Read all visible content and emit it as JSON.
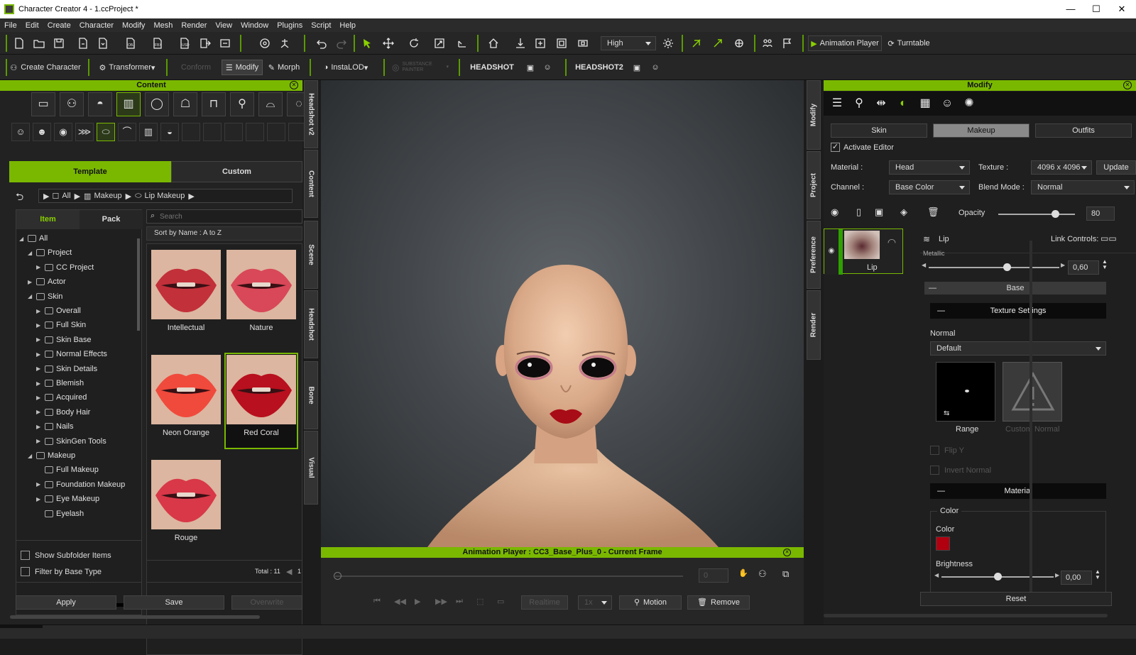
{
  "window": {
    "title": "Character Creator 4 - 1.ccProject *"
  },
  "menu": [
    "File",
    "Edit",
    "Create",
    "Character",
    "Modify",
    "Mesh",
    "Render",
    "View",
    "Window",
    "Plugins",
    "Script",
    "Help"
  ],
  "toolbar1": {
    "quality": "High",
    "animation_player": "Animation Player",
    "turntable": "Turntable"
  },
  "toolbar2": {
    "create_character": "Create Character",
    "transformer": "Transformer",
    "conform": "Conform",
    "modify": "Modify",
    "morph": "Morph",
    "instalod": "InstaLOD",
    "substance": "SUBSTANCE PAINTER",
    "headshot": "HEADSHOT",
    "headshot2": "HEADSHOT2"
  },
  "content": {
    "title": "Content",
    "tabs": {
      "template": "Template",
      "custom": "Custom"
    },
    "breadcrumb": {
      "all": "All",
      "makeup": "Makeup",
      "lip": "Lip Makeup"
    },
    "subtabs": {
      "item": "Item",
      "pack": "Pack"
    },
    "search_placeholder": "Search",
    "sort": "Sort by Name : A to Z",
    "tree": [
      {
        "label": "All",
        "indent": 0,
        "arrow": "◢"
      },
      {
        "label": "Project",
        "indent": 1,
        "arrow": "◢"
      },
      {
        "label": "CC Project",
        "indent": 2,
        "arrow": "▶"
      },
      {
        "label": "Actor",
        "indent": 1,
        "arrow": "▶"
      },
      {
        "label": "Skin",
        "indent": 1,
        "arrow": "◢"
      },
      {
        "label": "Overall",
        "indent": 2,
        "arrow": "▶"
      },
      {
        "label": "Full Skin",
        "indent": 2,
        "arrow": "▶"
      },
      {
        "label": "Skin Base",
        "indent": 2,
        "arrow": "▶"
      },
      {
        "label": "Normal Effects",
        "indent": 2,
        "arrow": "▶"
      },
      {
        "label": "Skin Details",
        "indent": 2,
        "arrow": "▶"
      },
      {
        "label": "Blemish",
        "indent": 2,
        "arrow": "▶"
      },
      {
        "label": "Acquired",
        "indent": 2,
        "arrow": "▶"
      },
      {
        "label": "Body Hair",
        "indent": 2,
        "arrow": "▶"
      },
      {
        "label": "Nails",
        "indent": 2,
        "arrow": "▶"
      },
      {
        "label": "SkinGen Tools",
        "indent": 2,
        "arrow": "▶"
      },
      {
        "label": "Makeup",
        "indent": 1,
        "arrow": "◢"
      },
      {
        "label": "Full Makeup",
        "indent": 2,
        "arrow": ""
      },
      {
        "label": "Foundation Makeup",
        "indent": 2,
        "arrow": "▶"
      },
      {
        "label": "Eye Makeup",
        "indent": 2,
        "arrow": "▶"
      },
      {
        "label": "Eyelash",
        "indent": 2,
        "arrow": ""
      }
    ],
    "items": [
      {
        "label": "Intellectual",
        "color": "#c2303a"
      },
      {
        "label": "Nature",
        "color": "#d84858"
      },
      {
        "label": "Neon Orange",
        "color": "#f04a3c"
      },
      {
        "label": "Red Coral",
        "color": "#b8101e"
      },
      {
        "label": "Rouge",
        "color": "#d83848"
      }
    ],
    "show_subfolder": "Show Subfolder Items",
    "filter_base": "Filter by Base Type",
    "total": "Total : 11",
    "page": "1",
    "apply": "Apply",
    "save": "Save",
    "overwrite": "Overwrite"
  },
  "left_vtabs": [
    "Headshot v2",
    "Content",
    "Scene",
    "Headshot",
    "Bone",
    "Visual"
  ],
  "right_vtabs": [
    "Modify",
    "Project",
    "Preference",
    "Render"
  ],
  "anim": {
    "title": "Animation Player : CC3_Base_Plus_0 - Current Frame",
    "frame": "0",
    "realtime": "Realtime",
    "speed": "1x",
    "motion": "Motion",
    "remove": "Remove"
  },
  "modify": {
    "title": "Modify",
    "tabs": {
      "skin": "Skin",
      "makeup": "Makeup",
      "outfits": "Outfits"
    },
    "activate_editor": "Activate Editor",
    "material_label": "Material :",
    "material": "Head",
    "texture_label": "Texture :",
    "texture": "4096 x 4096",
    "update": "Update",
    "channel_label": "Channel :",
    "channel": "Base Color",
    "blend_label": "Blend Mode :",
    "blend": "Normal",
    "opacity_label": "Opacity",
    "opacity": "80",
    "layer_name": "Lip",
    "section_lip": "Lip",
    "link_controls": "Link Controls:",
    "metallic_label": "Metallic",
    "metallic": "0,60",
    "base": "Base",
    "texture_settings": "Texture Settings",
    "normal_label": "Normal",
    "normal": "Default",
    "range": "Range",
    "custom_normal": "Custom Normal",
    "flip_y": "Flip Y",
    "invert_normal": "Invert Normal",
    "material_section": "Material",
    "color_group": "Color",
    "color_label": "Color",
    "color_value": "#b00010",
    "brightness_label": "Brightness",
    "brightness": "0,00",
    "reset": "Reset"
  }
}
